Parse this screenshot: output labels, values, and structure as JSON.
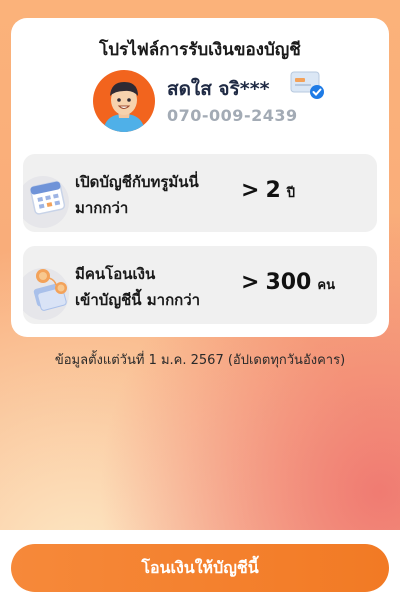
{
  "card": {
    "title": "โปรไฟล์การรับเงินของบัญชี",
    "name": "สดใส จริ***",
    "phone": "070-009-2439"
  },
  "stats": [
    {
      "label_line1": "เปิดบัญชีกับทรูมันนี่",
      "label_line2": "มากกว่า",
      "prefix": ">",
      "value": "2",
      "unit": "ปี",
      "icon": "calendar-icon"
    },
    {
      "label_line1": "มีคนโอนเงิน",
      "label_line2": "เข้าบัญชีนี้ มากกว่า",
      "prefix": ">",
      "value": "300",
      "unit": "คน",
      "icon": "money-transfer-icon"
    }
  ],
  "footnote": "ข้อมูลตั้งแต่วันที่ 1 ม.ค. 2567 (อัปเดตทุกวันอังคาร)",
  "button": {
    "label": "โอนเงินให้บัญชีนี้"
  },
  "colors": {
    "accent": "#f27a24",
    "verified": "#1e7be6",
    "avatar_bg": "#f2641e"
  }
}
